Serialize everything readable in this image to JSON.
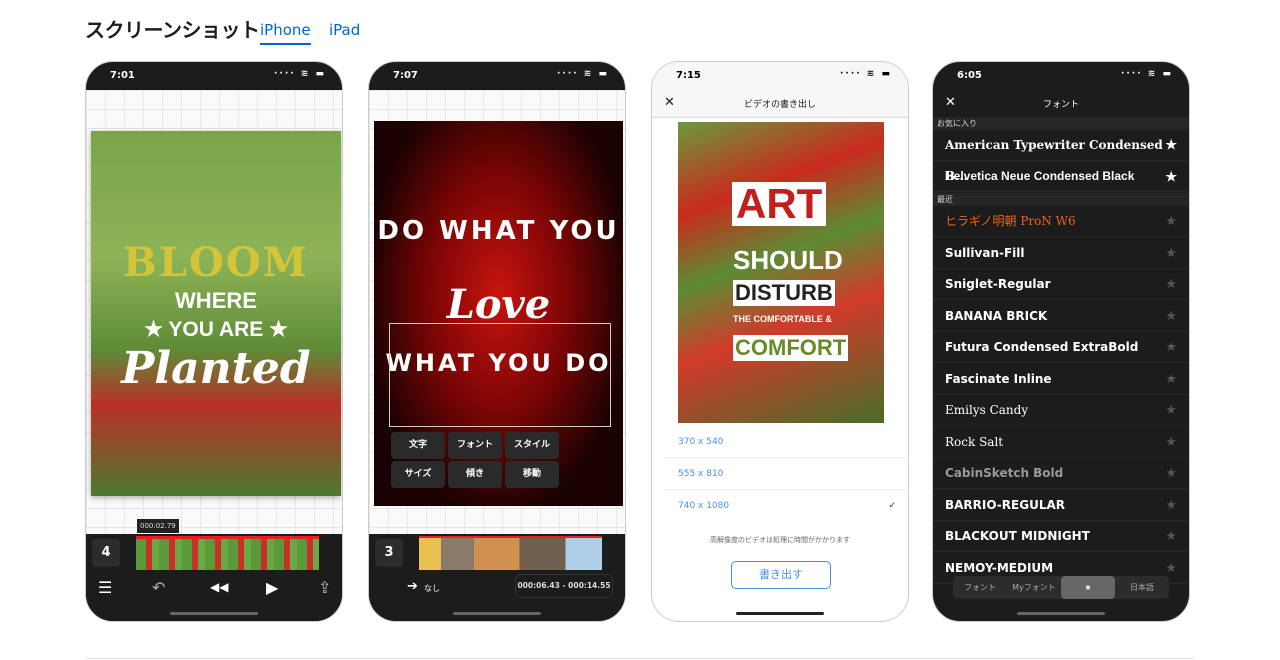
{
  "header": {
    "title": "スクリーンショット",
    "tabs": [
      {
        "label": "iPhone",
        "active": true
      },
      {
        "label": "iPad",
        "active": false
      }
    ]
  },
  "colors": {
    "accent": "#0066cc",
    "phone_dark": "#1c1c1c",
    "highlight_orange": "#e8651a",
    "link_blue": "#4a90e2"
  },
  "phones": [
    {
      "time": "7:01",
      "poster": {
        "line1": "BLOOM",
        "line2": "WHERE",
        "line3": "★ YOU ARE ★",
        "line4": "Planted"
      },
      "timecode": "000:02.79",
      "track": "4",
      "controls": {
        "menu": "☰",
        "undo": "↶",
        "rewind": "◀◀",
        "play": "▶",
        "share": "⇪"
      }
    },
    {
      "time": "7:07",
      "poster": {
        "top_arc": "DO WHAT YOU",
        "middle": "Love",
        "bottom_arc": "WHAT YOU DO"
      },
      "menu": [
        "文字",
        "フォント",
        "スタイル",
        "サイズ",
        "傾き",
        "移動"
      ],
      "track": "3",
      "transition": "なし",
      "range": "000:06.43 - 000:14.55"
    },
    {
      "time": "7:15",
      "nav_title": "ビデオの書き出し",
      "poster": {
        "line1": "ART",
        "line2": "SHOULD",
        "line3": "DISTURB",
        "line4": "THE COMFORTABLE &",
        "line5": "COMFORT"
      },
      "resolutions": [
        {
          "label": "370 x 540",
          "selected": false
        },
        {
          "label": "555 x 810",
          "selected": false
        },
        {
          "label": "740 x 1080",
          "selected": true
        }
      ],
      "note": "高解像度のビデオは処理に時間がかかります",
      "export_label": "書き出す"
    },
    {
      "time": "6:05",
      "nav_title": "フォント",
      "favorites_header": "お気に入り",
      "recent_header": "最近",
      "favorites": [
        "American Typewriter Condensed B...",
        "Helvetica Neue Condensed Black"
      ],
      "recent": [
        "ヒラギノ明朝 ProN W6",
        "Sullivan-Fill",
        "Sniglet-Regular",
        "BANANA BRICK",
        "Futura Condensed ExtraBold",
        "Fascinate Inline",
        "Emilys Candy",
        "Rock Salt",
        "CabinSketch Bold",
        "BARRIO-REGULAR",
        "BLACKOUT MIDNIGHT",
        "NEMOY-MEDIUM"
      ],
      "segments": [
        {
          "label": "フォント",
          "active": false
        },
        {
          "label": "Myフォント",
          "active": false
        },
        {
          "label": "★",
          "active": true
        },
        {
          "label": "日本語",
          "active": false
        }
      ]
    }
  ]
}
